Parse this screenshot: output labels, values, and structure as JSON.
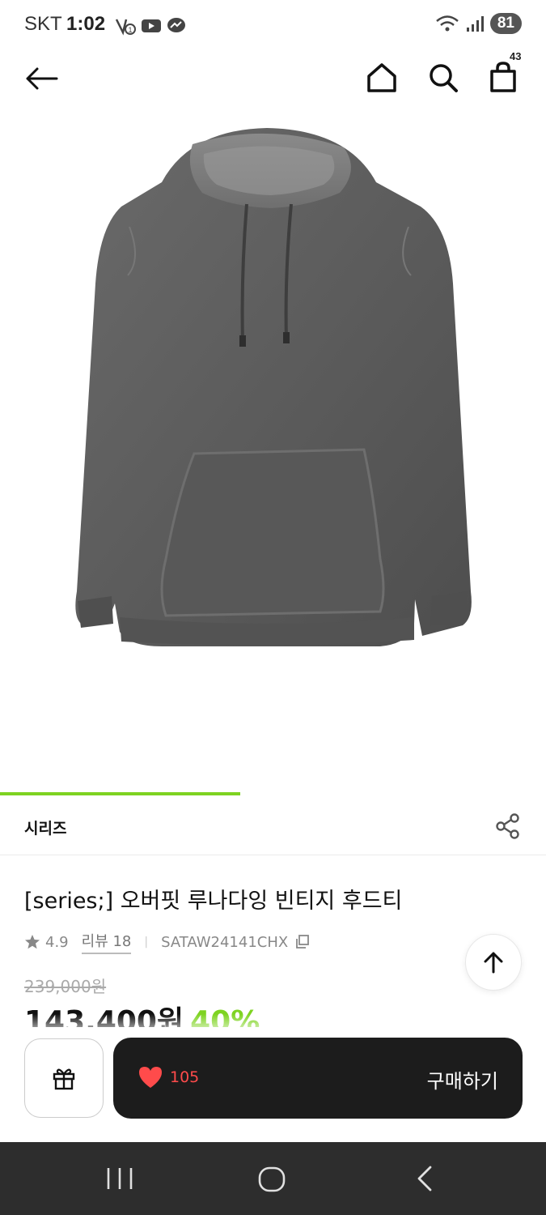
{
  "status_bar": {
    "carrier": "SKT",
    "time": "1:02",
    "battery": "81"
  },
  "header": {
    "cart_count": "43"
  },
  "image_progress": 0.44,
  "brand": {
    "name": "시리즈"
  },
  "product": {
    "title": "[series;] 오버핏 루나다잉 빈티지 후드티",
    "rating": "4.9",
    "review_label": "리뷰 18",
    "product_code": "SATAW24141CHX",
    "original_price": "239,000원",
    "sale_price": "143,400원",
    "discount": "40%"
  },
  "cta": {
    "like_count": "105",
    "buy_label": "구매하기"
  },
  "colors": {
    "accent_green": "#7ed321",
    "like_red": "#ff4b4b",
    "cta_dark": "#1c1c1c"
  },
  "icons": [
    "back-arrow-icon",
    "home-icon",
    "search-icon",
    "shopping-bag-icon",
    "share-icon",
    "star-icon",
    "copy-icon",
    "arrow-up-icon",
    "gift-icon",
    "heart-icon",
    "nav-recent-icon",
    "nav-home-icon",
    "nav-back-icon"
  ]
}
